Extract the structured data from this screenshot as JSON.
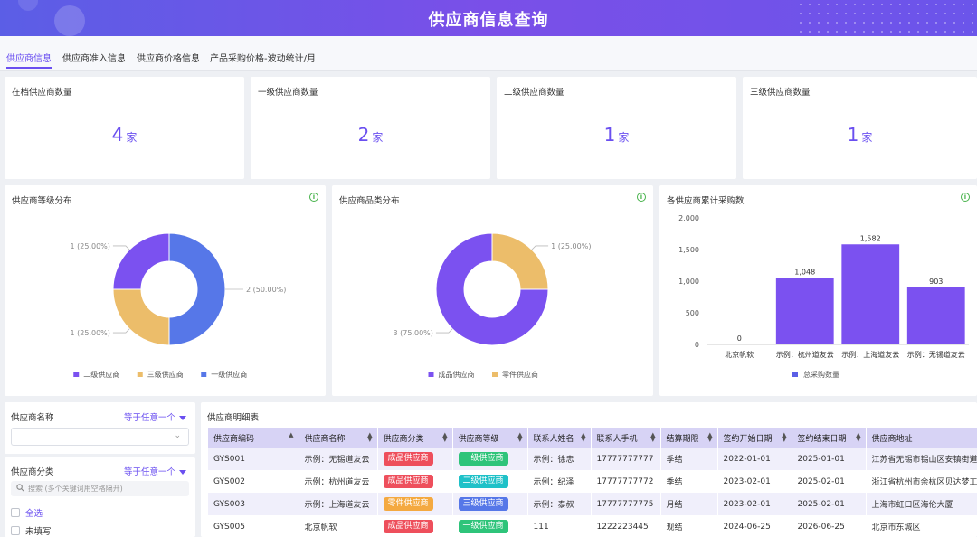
{
  "header": {
    "title": "供应商信息查询"
  },
  "tabs": [
    "供应商信息",
    "供应商准入信息",
    "供应商价格信息",
    "产品采购价格-波动统计/月"
  ],
  "stats": [
    {
      "label": "在档供应商数量",
      "value": "4",
      "unit": "家"
    },
    {
      "label": "一级供应商数量",
      "value": "2",
      "unit": "家"
    },
    {
      "label": "二级供应商数量",
      "value": "1",
      "unit": "家"
    },
    {
      "label": "三级供应商数量",
      "value": "1",
      "unit": "家"
    }
  ],
  "colors": {
    "purple": "#7b51f0",
    "blue": "#5677e8",
    "gold": "#ecbd6a",
    "accent": "#6a4ff0",
    "red": "#ee4f5c",
    "green": "#2ec47a",
    "teal": "#1fc1c8",
    "orange": "#f4a940"
  },
  "chart_data": [
    {
      "type": "pie",
      "title": "供应商等级分布",
      "categories": [
        "二级供应商",
        "三级供应商",
        "一级供应商"
      ],
      "values": [
        1,
        1,
        2
      ],
      "labels": [
        "1 (25.00%)",
        "1 (25.00%)",
        "2 (50.00%)"
      ],
      "colors": [
        "#7b51f0",
        "#ecbd6a",
        "#5677e8"
      ],
      "legend": "bottom"
    },
    {
      "type": "pie",
      "title": "供应商品类分布",
      "categories": [
        "成品供应商",
        "零件供应商"
      ],
      "values": [
        3,
        1
      ],
      "labels": [
        "3 (75.00%)",
        "1 (25.00%)"
      ],
      "colors": [
        "#7b51f0",
        "#ecbd6a"
      ],
      "legend": "bottom"
    },
    {
      "type": "bar",
      "title": "各供应商累计采购数",
      "categories": [
        "北京帆软",
        "示例：杭州道友云",
        "示例：上海道友云",
        "示例：无锡道友云"
      ],
      "series": [
        {
          "name": "总采购数量",
          "values": [
            0,
            1048,
            1582,
            903
          ]
        }
      ],
      "value_labels": [
        "0",
        "1,048",
        "1,582",
        "903"
      ],
      "ylim": [
        0,
        2000
      ],
      "yticks": [
        "0",
        "500",
        "1,000",
        "1,500",
        "2,000"
      ],
      "grid": false,
      "legend": "bottom"
    }
  ],
  "filters": {
    "name": {
      "label": "供应商名称",
      "op": "等于任意一个"
    },
    "category": {
      "label": "供应商分类",
      "op": "等于任意一个",
      "search_placeholder": "搜索 (多个关键词用空格隔开)",
      "options": [
        "全选",
        "未填写"
      ]
    }
  },
  "table": {
    "title": "供应商明细表",
    "columns": [
      "供应商编码",
      "供应商名称",
      "供应商分类",
      "供应商等级",
      "联系人姓名",
      "联系人手机",
      "结算期限",
      "签约开始日期",
      "签约结束日期",
      "供应商地址"
    ],
    "rows": [
      [
        "GYS001",
        "示例：无锡道友云",
        "成品供应商",
        "一级供应商",
        "示例：徐忠",
        "17777777777",
        "季结",
        "2022-01-01",
        "2025-01-01",
        "江苏省无锡市锡山区安镇街道"
      ],
      [
        "GYS002",
        "示例：杭州道友云",
        "成品供应商",
        "二级供应商",
        "示例：纪泽",
        "17777777772",
        "季结",
        "2023-02-01",
        "2025-02-01",
        "浙江省杭州市余杭区贝达梦工场"
      ],
      [
        "GYS003",
        "示例：上海道友云",
        "零件供应商",
        "三级供应商",
        "示例：泰叔",
        "17777777775",
        "月结",
        "2023-02-01",
        "2025-02-01",
        "上海市虹口区海伦大厦"
      ],
      [
        "GYS005",
        "北京帆软",
        "成品供应商",
        "一级供应商",
        "111",
        "1222223445",
        "现结",
        "2024-06-25",
        "2026-06-25",
        "北京市东城区"
      ]
    ]
  }
}
